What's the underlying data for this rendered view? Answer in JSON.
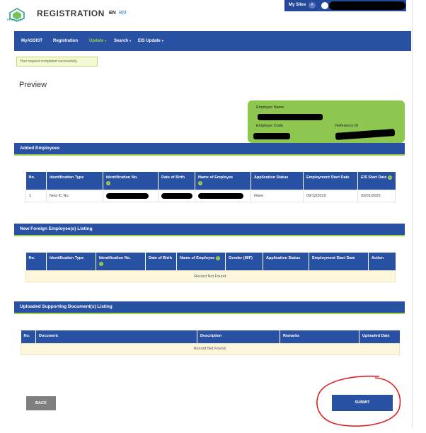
{
  "header": {
    "logo_text": "PERKESO",
    "app_title": "REGISTRATION",
    "lang_en": "EN",
    "lang_bm": "BM",
    "mysites_label": "My Sites",
    "mysites_caret": "▾"
  },
  "nav": {
    "items": [
      {
        "label": "MyASSIST",
        "caret": ""
      },
      {
        "label": "Registration",
        "caret": ""
      },
      {
        "label": "Update",
        "caret": "▾",
        "active": true
      },
      {
        "label": "Search",
        "caret": "▾"
      },
      {
        "label": "EIS Update",
        "caret": "▾"
      }
    ]
  },
  "alert": {
    "message": "Your request completed successfully."
  },
  "page_title": "Preview",
  "employer_card": {
    "employer_name_label": "Employer Name",
    "employer_code_label": "Employer Code",
    "reference_id_label": "Reference ID"
  },
  "added_employees": {
    "title": "Added Employees",
    "columns": [
      "No.",
      "Identification Type",
      "Identification No.",
      "Date of Birth",
      "Name of Employee",
      "Application Status",
      "Employment Start Date",
      "EIS Start Date"
    ],
    "rows": [
      {
        "no": "1",
        "id_type": "New IC No.",
        "status": "None",
        "emp_start": "09/12/2019",
        "eis_start": "03/01/2020"
      }
    ]
  },
  "foreign_employees": {
    "title": "New Foreign Employee(s) Listing",
    "columns": [
      "No.",
      "Identification Type",
      "Identification No.",
      "Date of Birth",
      "Name of Employee",
      "Gender (M/F)",
      "Application Status",
      "Employment Start Date",
      "Action"
    ],
    "empty_message": "Record Not Found."
  },
  "supporting_docs": {
    "title": "Uploaded Supporting Document(s) Listing",
    "columns": [
      "No.",
      "Document",
      "Description",
      "Remarks",
      "Uploaded Date"
    ],
    "empty_message": "Record Not Found."
  },
  "buttons": {
    "back": "BACK",
    "submit": "SUBMIT"
  },
  "colors": {
    "nav_blue": "#2951a3",
    "accent_green": "#9fd14b",
    "card_green": "#8dc750",
    "annotation_red": "#e02020"
  }
}
